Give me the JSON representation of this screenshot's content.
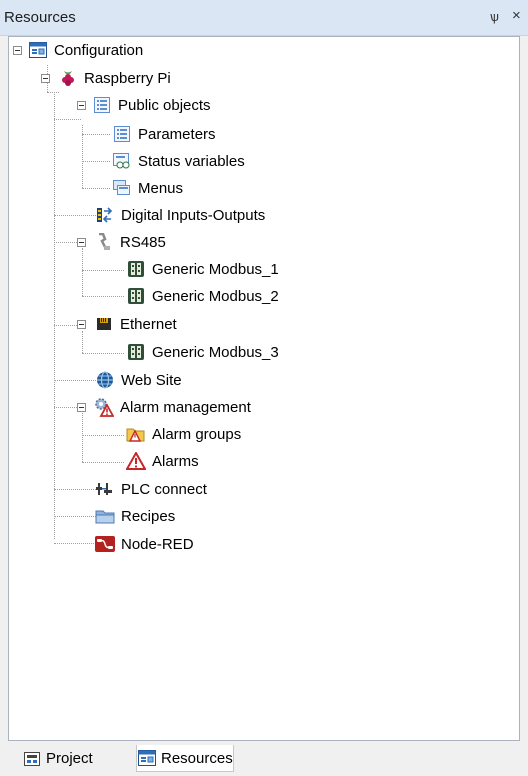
{
  "panel": {
    "title": "Resources",
    "pin_glyph": "ѱ",
    "close_glyph": "×"
  },
  "tree": [
    {
      "label": "Configuration",
      "icon": "configuration-icon",
      "expanded": true
    },
    {
      "label": "Raspberry Pi",
      "icon": "raspberry-pi-icon",
      "expanded": true
    },
    {
      "label": "Public objects",
      "icon": "public-objects-icon",
      "expanded": true
    },
    {
      "label": "Parameters",
      "icon": "parameters-icon"
    },
    {
      "label": "Status variables",
      "icon": "status-variables-icon"
    },
    {
      "label": "Menus",
      "icon": "menus-icon"
    },
    {
      "label": "Digital Inputs-Outputs",
      "icon": "digital-io-icon"
    },
    {
      "label": "RS485",
      "icon": "rs485-icon",
      "expanded": true
    },
    {
      "label": "Generic Modbus_1",
      "icon": "modbus-device-icon"
    },
    {
      "label": "Generic Modbus_2",
      "icon": "modbus-device-icon"
    },
    {
      "label": "Ethernet",
      "icon": "ethernet-icon",
      "expanded": true
    },
    {
      "label": "Generic Modbus_3",
      "icon": "modbus-device-icon"
    },
    {
      "label": "Web Site",
      "icon": "web-site-icon"
    },
    {
      "label": "Alarm management",
      "icon": "alarm-management-icon",
      "expanded": true
    },
    {
      "label": "Alarm groups",
      "icon": "alarm-groups-icon"
    },
    {
      "label": "Alarms",
      "icon": "alarm-warning-icon"
    },
    {
      "label": "PLC connect",
      "icon": "plc-connect-icon"
    },
    {
      "label": "Recipes",
      "icon": "recipes-icon"
    },
    {
      "label": "Node-RED",
      "icon": "node-red-icon"
    }
  ],
  "tabs": [
    {
      "label": "Project",
      "icon": "project-icon",
      "active": false
    },
    {
      "label": "Resources",
      "icon": "resources-icon",
      "active": true
    }
  ]
}
